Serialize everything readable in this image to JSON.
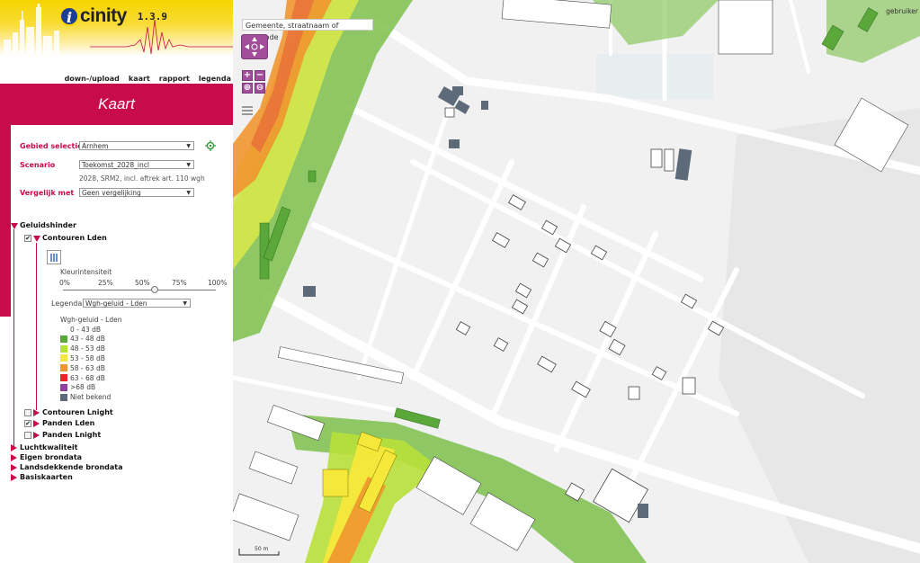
{
  "app": {
    "name": "cinity",
    "version": "1.3.9",
    "logo_letter": "i"
  },
  "topnav": [
    "down-/upload",
    "kaart",
    "rapport",
    "legenda"
  ],
  "page_title": "Kaart",
  "form": {
    "gebied_label": "Gebied selectie",
    "gebied_value": "Arnhem",
    "scenario_label": "Scenario",
    "scenario_value": "Toekomst_2028_incl",
    "scenario_subtext": "2028, SRM2, incl. aftrek art. 110 wgh",
    "vergelijk_label": "Vergelijk met",
    "vergelijk_value": "Geen vergelijking"
  },
  "tree": {
    "geluidshinder": "Geluidshinder",
    "contouren_lden": "Contouren Lden",
    "kleurintensiteit_label": "Kleurintensiteit",
    "ticks": [
      "0%",
      "25%",
      "50%",
      "75%",
      "100%"
    ],
    "intensity": 0.6,
    "legenda_label": "Legenda:",
    "legenda_value": "Wgh-geluid - Lden",
    "legend_title": "Wgh-geluid - Lden",
    "legend": [
      {
        "label": "0 - 43 dB",
        "color": ""
      },
      {
        "label": "43 - 48 dB",
        "color": "#5aa83a"
      },
      {
        "label": "48 - 53 dB",
        "color": "#b7e03a"
      },
      {
        "label": "53 - 58 dB",
        "color": "#f5e83a"
      },
      {
        "label": "58 - 63 dB",
        "color": "#f0962f"
      },
      {
        "label": "63 - 68 dB",
        "color": "#e8242a"
      },
      {
        "label": ">68 dB",
        "color": "#8f3fa0"
      },
      {
        "label": "Niet bekend",
        "color": "#5c6a7a"
      }
    ],
    "contouren_lnight": "Contouren Lnight",
    "panden_lden": "Panden Lden",
    "panden_lnight": "Panden Lnight",
    "luchtkwaliteit": "Luchtkwaliteit",
    "eigen_brondata": "Eigen brondata",
    "landsdekkende_brondata": "Landsdekkende brondata",
    "basiskaarten": "Basiskaarten"
  },
  "map": {
    "search_placeholder": "Gemeente, straatnaam of postcode",
    "user_link": "gebruiker",
    "scale": "50 m"
  }
}
